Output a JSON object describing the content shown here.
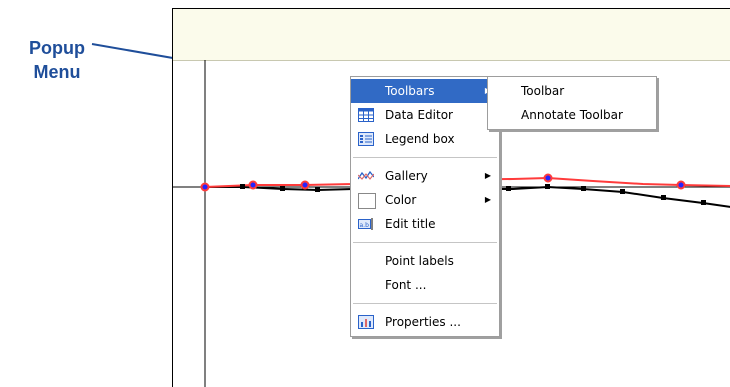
{
  "annotation": {
    "line1": "Popup",
    "line2": "Menu"
  },
  "context_menu": {
    "items": [
      {
        "label": "Toolbars",
        "icon": "none",
        "submenu": true
      },
      {
        "label": "Data Editor",
        "icon": "grid-icon"
      },
      {
        "label": "Legend box",
        "icon": "legend-icon"
      },
      {
        "label": "Gallery",
        "icon": "gallery-icon",
        "submenu": true
      },
      {
        "label": "Color",
        "icon": "color-square-icon",
        "submenu": true
      },
      {
        "label": "Edit title",
        "icon": "edit-title-icon"
      },
      {
        "label": "Point labels",
        "icon": "none"
      },
      {
        "label": "Font ...",
        "icon": "none"
      },
      {
        "label": "Properties ...",
        "icon": "properties-icon"
      }
    ]
  },
  "submenu": {
    "items": [
      {
        "label": "Toolbar"
      },
      {
        "label": "Annotate Toolbar"
      }
    ]
  },
  "colors": {
    "highlight": "#316ac5",
    "annotation": "#1f4e9a",
    "series_red": "#ff3b3b",
    "series_black": "#000000",
    "marker_blue": "#2424ff",
    "header_bg": "#fbfbeb"
  }
}
